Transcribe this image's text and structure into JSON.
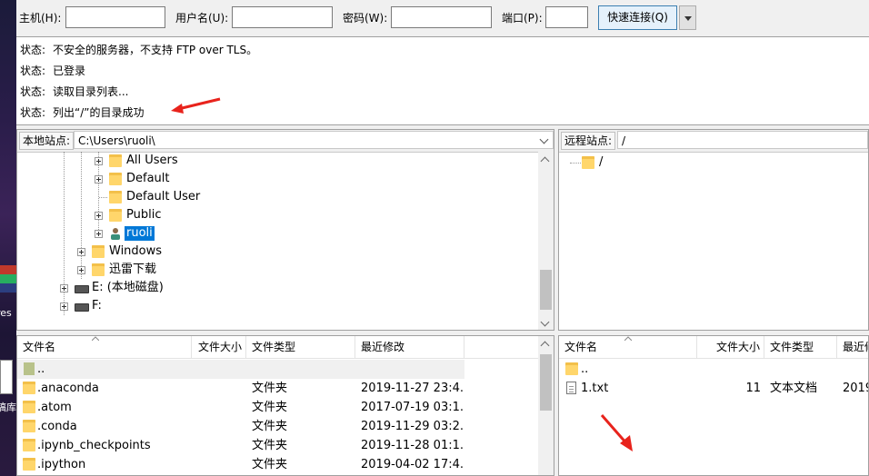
{
  "quickconnect": {
    "host_label": "主机(H):",
    "user_label": "用户名(U):",
    "pass_label": "密码(W):",
    "port_label": "端口(P):",
    "host_value": "",
    "user_value": "",
    "pass_value": "",
    "port_value": "",
    "connect_label": "快速连接(Q)"
  },
  "status_log": [
    {
      "label": "状态:",
      "text": "不安全的服务器，不支持 FTP over TLS。"
    },
    {
      "label": "状态:",
      "text": "已登录"
    },
    {
      "label": "状态:",
      "text": "读取目录列表..."
    },
    {
      "label": "状态:",
      "text": "列出“/”的目录成功"
    }
  ],
  "local_site": {
    "label": "本地站点:",
    "path": "C:\\Users\\ruoli\\",
    "tree": [
      {
        "name": "All Users",
        "type": "folder",
        "selected": false
      },
      {
        "name": "Default",
        "type": "folder",
        "selected": false
      },
      {
        "name": "Default User",
        "type": "folder",
        "selected": false
      },
      {
        "name": "Public",
        "type": "folder",
        "selected": false
      },
      {
        "name": "ruoli",
        "type": "user",
        "selected": true
      },
      {
        "name": "Windows",
        "type": "folder",
        "selected": false
      },
      {
        "name": "迅雷下载",
        "type": "folder",
        "selected": false
      },
      {
        "name": "E: (本地磁盘)",
        "type": "drive",
        "selected": false
      },
      {
        "name": "F:",
        "type": "drive",
        "selected": false
      }
    ]
  },
  "remote_site": {
    "label": "远程站点:",
    "path": "/",
    "tree": [
      {
        "name": "/",
        "type": "folder"
      }
    ]
  },
  "local_files": {
    "columns": [
      "文件名",
      "文件大小",
      "文件类型",
      "最近修改"
    ],
    "rows": [
      {
        "name": "..",
        "size": "",
        "type": "",
        "modified": ""
      },
      {
        "name": ".anaconda",
        "size": "",
        "type": "文件夹",
        "modified": "2019-11-27 23:4..."
      },
      {
        "name": ".atom",
        "size": "",
        "type": "文件夹",
        "modified": "2017-07-19 03:1..."
      },
      {
        "name": ".conda",
        "size": "",
        "type": "文件夹",
        "modified": "2019-11-29 03:2..."
      },
      {
        "name": ".ipynb_checkpoints",
        "size": "",
        "type": "文件夹",
        "modified": "2019-11-28 01:1..."
      },
      {
        "name": ".ipython",
        "size": "",
        "type": "文件夹",
        "modified": "2019-04-02 17:4..."
      }
    ]
  },
  "remote_files": {
    "columns": [
      "文件名",
      "文件大小",
      "文件类型",
      "最近修"
    ],
    "rows": [
      {
        "name": "..",
        "size": "",
        "type": "",
        "modified": ""
      },
      {
        "name": "1.txt",
        "size": "11",
        "type": "文本文档",
        "modified": "2019"
      }
    ]
  },
  "desktop_fragments": {
    "left_text_1": "res",
    "left_text_2": "稿库"
  },
  "colors": {
    "annotation_arrow": "#e8231c",
    "selection": "#0078d7",
    "folder": "#ffd66b"
  }
}
